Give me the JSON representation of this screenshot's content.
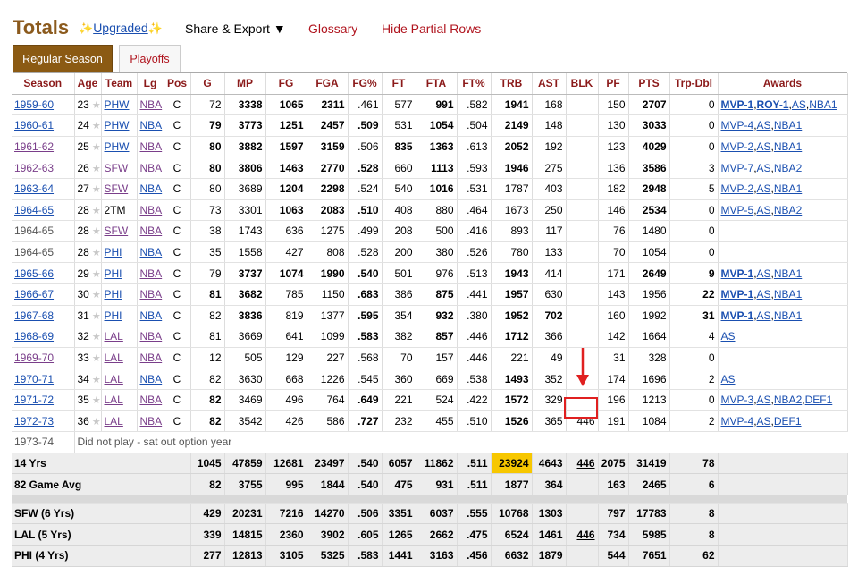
{
  "header": {
    "title": "Totals",
    "upgraded_label": "Upgraded",
    "share_label": "Share & Export ▼",
    "glossary_label": "Glossary",
    "hide_partial_label": "Hide Partial Rows"
  },
  "tabs": [
    {
      "label": "Regular Season",
      "active": true
    },
    {
      "label": "Playoffs",
      "active": false
    }
  ],
  "columns": [
    "Season",
    "Age",
    "Team",
    "Lg",
    "Pos",
    "G",
    "MP",
    "FG",
    "FGA",
    "FG%",
    "FT",
    "FTA",
    "FT%",
    "TRB",
    "AST",
    "BLK",
    "PF",
    "PTS",
    "Trp-Dbl",
    "Awards"
  ],
  "rows": [
    [
      "1959-60",
      "23",
      "PHW",
      "NBA",
      "C",
      "72",
      "3338",
      "1065",
      "2311",
      ".461",
      "577",
      "991",
      ".582",
      "1941",
      "168",
      "",
      "150",
      "2707",
      "0",
      "MVP-1,ROY-1,AS,NBA1"
    ],
    [
      "1960-61",
      "24",
      "PHW",
      "NBA",
      "C",
      "79",
      "3773",
      "1251",
      "2457",
      ".509",
      "531",
      "1054",
      ".504",
      "2149",
      "148",
      "",
      "130",
      "3033",
      "0",
      "MVP-4,AS,NBA1"
    ],
    [
      "1961-62",
      "25",
      "PHW",
      "NBA",
      "C",
      "80",
      "3882",
      "1597",
      "3159",
      ".506",
      "835",
      "1363",
      ".613",
      "2052",
      "192",
      "",
      "123",
      "4029",
      "0",
      "MVP-2,AS,NBA1"
    ],
    [
      "1962-63",
      "26",
      "SFW",
      "NBA",
      "C",
      "80",
      "3806",
      "1463",
      "2770",
      ".528",
      "660",
      "1113",
      ".593",
      "1946",
      "275",
      "",
      "136",
      "3586",
      "3",
      "MVP-7,AS,NBA2"
    ],
    [
      "1963-64",
      "27",
      "SFW",
      "NBA",
      "C",
      "80",
      "3689",
      "1204",
      "2298",
      ".524",
      "540",
      "1016",
      ".531",
      "1787",
      "403",
      "",
      "182",
      "2948",
      "5",
      "MVP-2,AS,NBA1"
    ],
    [
      "1964-65",
      "28",
      "2TM",
      "NBA",
      "C",
      "73",
      "3301",
      "1063",
      "2083",
      ".510",
      "408",
      "880",
      ".464",
      "1673",
      "250",
      "",
      "146",
      "2534",
      "0",
      "MVP-5,AS,NBA2"
    ],
    [
      "1964-65",
      "28",
      "SFW",
      "NBA",
      "C",
      "38",
      "1743",
      "636",
      "1275",
      ".499",
      "208",
      "500",
      ".416",
      "893",
      "117",
      "",
      "76",
      "1480",
      "0",
      ""
    ],
    [
      "1964-65",
      "28",
      "PHI",
      "NBA",
      "C",
      "35",
      "1558",
      "427",
      "808",
      ".528",
      "200",
      "380",
      ".526",
      "780",
      "133",
      "",
      "70",
      "1054",
      "0",
      ""
    ],
    [
      "1965-66",
      "29",
      "PHI",
      "NBA",
      "C",
      "79",
      "3737",
      "1074",
      "1990",
      ".540",
      "501",
      "976",
      ".513",
      "1943",
      "414",
      "",
      "171",
      "2649",
      "9",
      "MVP-1,AS,NBA1"
    ],
    [
      "1966-67",
      "30",
      "PHI",
      "NBA",
      "C",
      "81",
      "3682",
      "785",
      "1150",
      ".683",
      "386",
      "875",
      ".441",
      "1957",
      "630",
      "",
      "143",
      "1956",
      "22",
      "MVP-1,AS,NBA1"
    ],
    [
      "1967-68",
      "31",
      "PHI",
      "NBA",
      "C",
      "82",
      "3836",
      "819",
      "1377",
      ".595",
      "354",
      "932",
      ".380",
      "1952",
      "702",
      "",
      "160",
      "1992",
      "31",
      "MVP-1,AS,NBA1"
    ],
    [
      "1968-69",
      "32",
      "LAL",
      "NBA",
      "C",
      "81",
      "3669",
      "641",
      "1099",
      ".583",
      "382",
      "857",
      ".446",
      "1712",
      "366",
      "",
      "142",
      "1664",
      "4",
      "AS"
    ],
    [
      "1969-70",
      "33",
      "LAL",
      "NBA",
      "C",
      "12",
      "505",
      "129",
      "227",
      ".568",
      "70",
      "157",
      ".446",
      "221",
      "49",
      "",
      "31",
      "328",
      "0",
      ""
    ],
    [
      "1970-71",
      "34",
      "LAL",
      "NBA",
      "C",
      "82",
      "3630",
      "668",
      "1226",
      ".545",
      "360",
      "669",
      ".538",
      "1493",
      "352",
      "",
      "174",
      "1696",
      "2",
      "AS"
    ],
    [
      "1971-72",
      "35",
      "LAL",
      "NBA",
      "C",
      "82",
      "3469",
      "496",
      "764",
      ".649",
      "221",
      "524",
      ".422",
      "1572",
      "329",
      "",
      "196",
      "1213",
      "0",
      "MVP-3,AS,NBA2,DEF1"
    ],
    [
      "1972-73",
      "36",
      "LAL",
      "NBA",
      "C",
      "82",
      "3542",
      "426",
      "586",
      ".727",
      "232",
      "455",
      ".510",
      "1526",
      "365",
      "446",
      "191",
      "1084",
      "2",
      "MVP-4,AS,DEF1"
    ]
  ],
  "bold_cells": [
    [
      0,
      6
    ],
    [
      0,
      7
    ],
    [
      0,
      8
    ],
    [
      0,
      11
    ],
    [
      0,
      13
    ],
    [
      0,
      17
    ],
    [
      1,
      5
    ],
    [
      1,
      6
    ],
    [
      1,
      7
    ],
    [
      1,
      8
    ],
    [
      1,
      9
    ],
    [
      1,
      11
    ],
    [
      1,
      13
    ],
    [
      1,
      17
    ],
    [
      2,
      5
    ],
    [
      2,
      6
    ],
    [
      2,
      7
    ],
    [
      2,
      8
    ],
    [
      2,
      10
    ],
    [
      2,
      11
    ],
    [
      2,
      13
    ],
    [
      2,
      17
    ],
    [
      3,
      5
    ],
    [
      3,
      6
    ],
    [
      3,
      7
    ],
    [
      3,
      8
    ],
    [
      3,
      9
    ],
    [
      3,
      11
    ],
    [
      3,
      13
    ],
    [
      3,
      17
    ],
    [
      4,
      7
    ],
    [
      4,
      8
    ],
    [
      4,
      11
    ],
    [
      4,
      17
    ],
    [
      5,
      7
    ],
    [
      5,
      8
    ],
    [
      5,
      9
    ],
    [
      5,
      17
    ],
    [
      8,
      6
    ],
    [
      8,
      7
    ],
    [
      8,
      8
    ],
    [
      8,
      9
    ],
    [
      8,
      13
    ],
    [
      8,
      17
    ],
    [
      8,
      18
    ],
    [
      9,
      5
    ],
    [
      9,
      6
    ],
    [
      9,
      9
    ],
    [
      9,
      11
    ],
    [
      9,
      13
    ],
    [
      9,
      18
    ],
    [
      10,
      6
    ],
    [
      10,
      9
    ],
    [
      10,
      11
    ],
    [
      10,
      13
    ],
    [
      10,
      14
    ],
    [
      10,
      18
    ],
    [
      11,
      9
    ],
    [
      11,
      11
    ],
    [
      11,
      13
    ],
    [
      13,
      13
    ],
    [
      14,
      5
    ],
    [
      14,
      9
    ],
    [
      14,
      13
    ],
    [
      15,
      5
    ],
    [
      15,
      9
    ],
    [
      15,
      13
    ]
  ],
  "bold_awards": {
    "0": [
      "MVP-1",
      "ROY-1"
    ],
    "8": [
      "MVP-1"
    ],
    "9": [
      "MVP-1"
    ],
    "10": [
      "MVP-1"
    ]
  },
  "dnp_row": {
    "season": "1973-74",
    "note": "Did not play - sat out option year"
  },
  "totals": [
    {
      "label": "14 Yrs",
      "values": [
        "1045",
        "47859",
        "12681",
        "23497",
        ".540",
        "6057",
        "11862",
        ".511",
        "23924",
        "4643",
        "446",
        "2075",
        "31419",
        "78"
      ]
    },
    {
      "label": "82 Game Avg",
      "values": [
        "82",
        "3755",
        "995",
        "1844",
        ".540",
        "475",
        "931",
        ".511",
        "1877",
        "364",
        "",
        "163",
        "2465",
        "6"
      ]
    }
  ],
  "team_totals": [
    {
      "label": "SFW (6 Yrs)",
      "values": [
        "429",
        "20231",
        "7216",
        "14270",
        ".506",
        "3351",
        "6037",
        ".555",
        "10768",
        "1303",
        "",
        "797",
        "17783",
        "8"
      ]
    },
    {
      "label": "LAL (5 Yrs)",
      "values": [
        "339",
        "14815",
        "2360",
        "3902",
        ".605",
        "1265",
        "2662",
        ".475",
        "6524",
        "1461",
        "446",
        "734",
        "5985",
        "8"
      ]
    },
    {
      "label": "PHI (4 Yrs)",
      "values": [
        "277",
        "12813",
        "3105",
        "5325",
        ".583",
        "1441",
        "3163",
        ".456",
        "6632",
        "1879",
        "",
        "544",
        "7651",
        "62"
      ]
    }
  ],
  "highlight_color": "#f7c700",
  "annotation_color": "#e02020"
}
